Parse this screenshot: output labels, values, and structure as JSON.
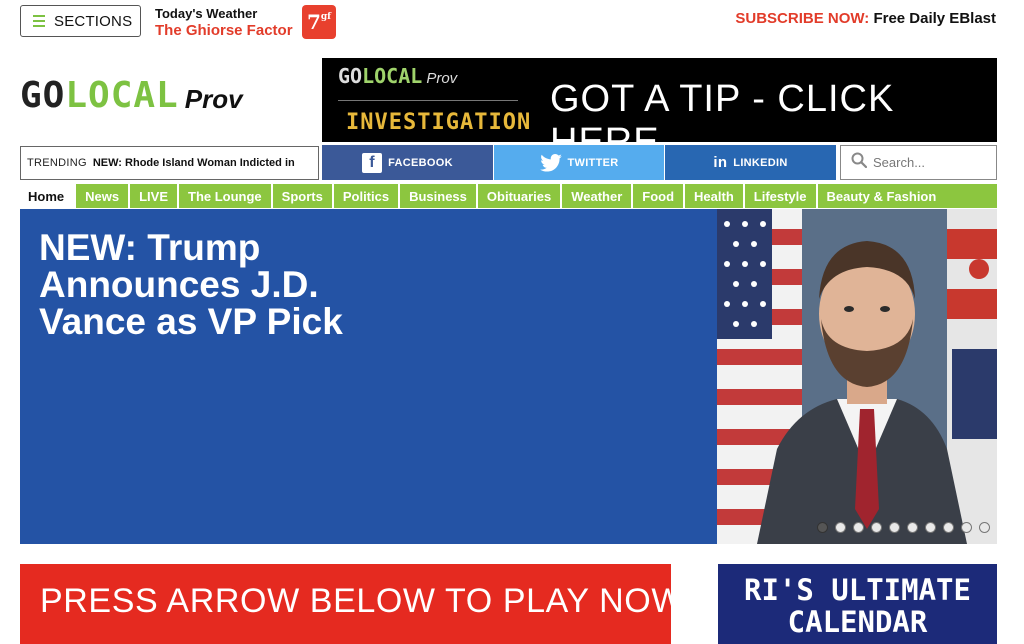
{
  "header": {
    "sections_label": "SECTIONS",
    "weather_title": "Today's Weather",
    "weather_subtitle": "The Ghiorse Factor",
    "weather_badge": "7",
    "weather_badge_sup": "gf",
    "subscribe_cta": "SUBSCRIBE NOW:",
    "subscribe_text": "Free Daily EBlast"
  },
  "logo": {
    "go": "GO",
    "local": "LOCAL",
    "prov": "Prov"
  },
  "tip_banner": {
    "go": "GO",
    "local": "LOCAL",
    "prov": "Prov",
    "investigation": "INVESTIGATION",
    "tip": "GOT A TIP - CLICK HERE"
  },
  "trending": {
    "label": "TRENDING",
    "headline": "NEW: Rhode Island Woman Indicted in"
  },
  "social": {
    "facebook": "FACEBOOK",
    "twitter": "TWITTER",
    "linkedin": "LINKEDIN"
  },
  "search": {
    "placeholder": "Search..."
  },
  "nav": {
    "items": [
      "Home",
      "News",
      "LIVE",
      "The Lounge",
      "Sports",
      "Politics",
      "Business",
      "Obituaries",
      "Weather",
      "Food",
      "Health",
      "Lifestyle",
      "Beauty & Fashion"
    ]
  },
  "hero": {
    "headline": "NEW: Trump Announces J.D. Vance as VP Pick",
    "slide_count": 10,
    "active_slide": 1
  },
  "promos": {
    "play": "PRESS ARROW BELOW TO PLAY NOW",
    "calendar_line1": "RI'S ULTIMATE",
    "calendar_line2": "CALENDAR"
  },
  "colors": {
    "brand_green": "#8cc63f",
    "accent_red": "#e23c2a",
    "hero_blue": "#2453a5",
    "facebook": "#3b5998",
    "twitter": "#55acee",
    "linkedin": "#2867b2"
  }
}
